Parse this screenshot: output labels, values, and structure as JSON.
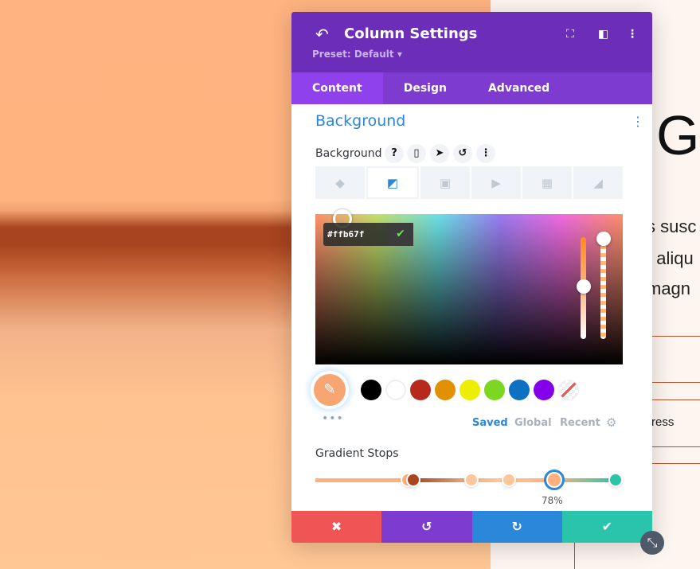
{
  "page": {
    "heading_letter": "G",
    "paragraph_lines": [
      "s susc",
      "t aliqu",
      "magn"
    ],
    "list_text": "ress"
  },
  "panel": {
    "title": "Column Settings",
    "preset": "Preset: Default ▾",
    "icons": {
      "back": "undo-arrow-icon",
      "focus": "fullscreen-icon",
      "layout": "split-view-icon",
      "more": "kebab-icon"
    },
    "tabs": [
      {
        "label": "Content",
        "active": true
      },
      {
        "label": "Design"
      },
      {
        "label": "Advanced"
      }
    ],
    "section_title": "Background",
    "field_label": "Background",
    "field_controls": [
      "?",
      "▯",
      "➤",
      "↺",
      "⋮"
    ],
    "background_types": [
      "color",
      "gradient",
      "image",
      "video",
      "pattern",
      "mask"
    ],
    "active_type": "gradient",
    "color_picker": {
      "hex": "#ffb67f",
      "confirm_icon": "check-icon"
    },
    "swatches": [
      "#000000",
      "#ffffff",
      "#b52a1c",
      "#e09000",
      "#eeee00",
      "#7cd622",
      "#0c71c3",
      "#8300e9",
      "transparent"
    ],
    "palette_tabs": [
      {
        "label": "Saved",
        "active": true
      },
      {
        "label": "Global"
      },
      {
        "label": "Recent"
      }
    ],
    "gradient_label": "Gradient Stops",
    "gradient_stops": [
      {
        "color": "#ffb07e",
        "position": 30
      },
      {
        "color": "#a8441f",
        "position": 32
      },
      {
        "color": "#ffc69a",
        "position": 51
      },
      {
        "color": "#ffc69a",
        "position": 63
      },
      {
        "color": "#ffb07e",
        "position": 78,
        "selected": true
      },
      {
        "color": "#2ac4a6",
        "position": 98
      }
    ],
    "selected_stop_label": "78%",
    "footer": [
      {
        "name": "cancel",
        "icon": "✖",
        "color": "#ef5555"
      },
      {
        "name": "undo",
        "icon": "↺",
        "color": "#7e3bd0"
      },
      {
        "name": "redo",
        "icon": "↻",
        "color": "#2b87da"
      },
      {
        "name": "save",
        "icon": "✔",
        "color": "#29c4a9"
      }
    ]
  }
}
